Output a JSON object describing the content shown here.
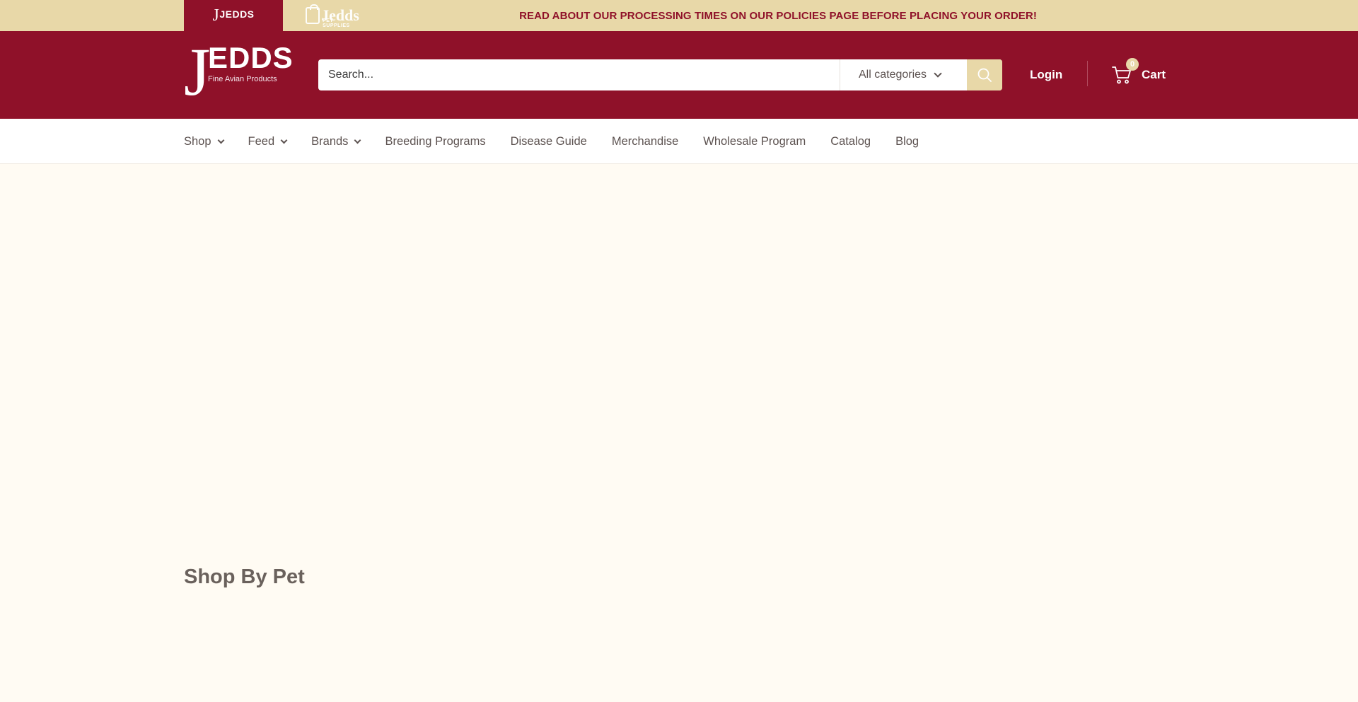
{
  "topbar": {
    "stores": [
      {
        "name": "JEDDS",
        "active": true
      },
      {
        "name": "Jedds",
        "sub": "PET SUPPLIES",
        "active": false
      }
    ],
    "announcement": "READ ABOUT OUR PROCESSING TIMES ON OUR POLICIES PAGE BEFORE PLACING YOUR ORDER!"
  },
  "header": {
    "logo_j": "J",
    "logo_word": "EDDS",
    "logo_tagline": "Fine Avian Products",
    "search_placeholder": "Search...",
    "category_select": "All categories",
    "login_label": "Login",
    "cart_label": "Cart",
    "cart_count": "0"
  },
  "nav": {
    "items": [
      {
        "label": "Shop",
        "dropdown": true
      },
      {
        "label": "Feed",
        "dropdown": true
      },
      {
        "label": "Brands",
        "dropdown": true
      },
      {
        "label": "Breeding Programs",
        "dropdown": false
      },
      {
        "label": "Disease Guide",
        "dropdown": false
      },
      {
        "label": "Merchandise",
        "dropdown": false
      },
      {
        "label": "Wholesale Program",
        "dropdown": false
      },
      {
        "label": "Catalog",
        "dropdown": false
      },
      {
        "label": "Blog",
        "dropdown": false
      }
    ]
  },
  "main": {
    "section_title": "Shop By Pet"
  },
  "colors": {
    "brand": "#8f1129",
    "accent": "#e8d8a8",
    "background": "#fffbf3"
  }
}
